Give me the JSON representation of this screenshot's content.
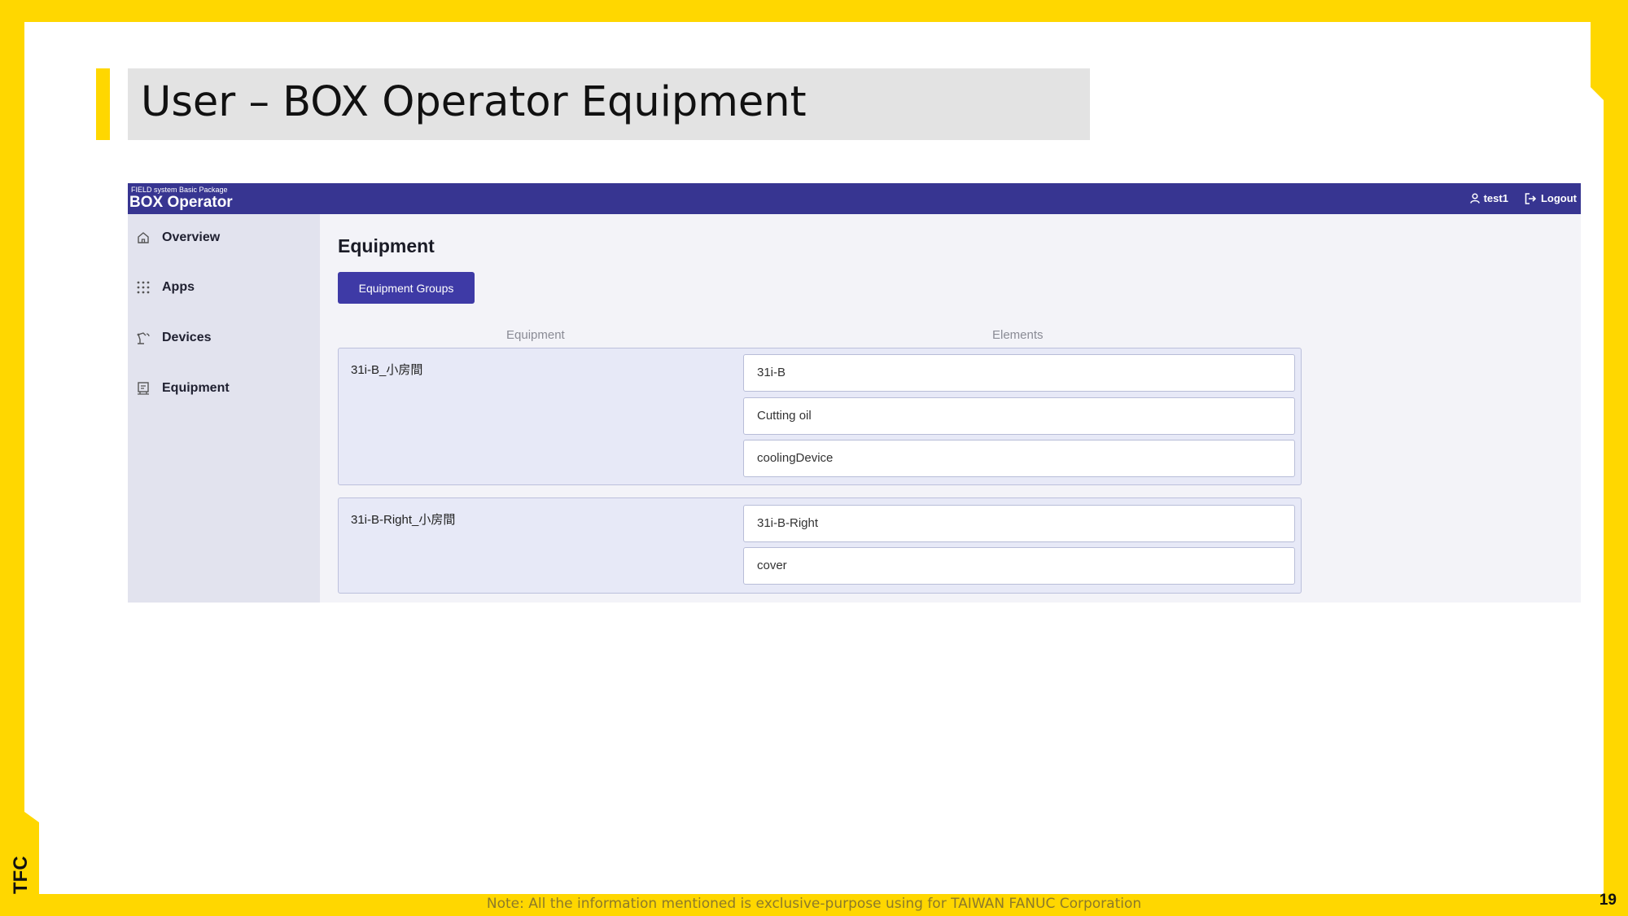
{
  "slide": {
    "title": "User – BOX Operator Equipment",
    "footer_note": "Note: All the information mentioned is exclusive-purpose using for TAIWAN FANUC Corporation",
    "page_number": "19",
    "logo_text": "TFC"
  },
  "app": {
    "brand_small": "FIELD system Basic Package",
    "brand_title": "BOX Operator",
    "user_label": "test1",
    "logout_label": "Logout",
    "sidebar": {
      "items": [
        {
          "label": "Overview",
          "icon": "home-icon"
        },
        {
          "label": "Apps",
          "icon": "grid-icon"
        },
        {
          "label": "Devices",
          "icon": "robot-arm-icon"
        },
        {
          "label": "Equipment",
          "icon": "equipment-icon"
        }
      ]
    },
    "page_title": "Equipment",
    "equipment_groups_button": "Equipment Groups",
    "columns": {
      "equipment": "Equipment",
      "elements": "Elements"
    },
    "equipment": [
      {
        "name": "31i-B_小房間",
        "elements": [
          "31i-B",
          "Cutting oil",
          "coolingDevice"
        ]
      },
      {
        "name": "31i-B-Right_小房間",
        "elements": [
          "31i-B-Right",
          "cover"
        ]
      }
    ],
    "colors": {
      "topbar": "#373591",
      "sidebar": "#e2e3ee",
      "button": "#3e3aa6",
      "accent": "#FFD700"
    }
  }
}
